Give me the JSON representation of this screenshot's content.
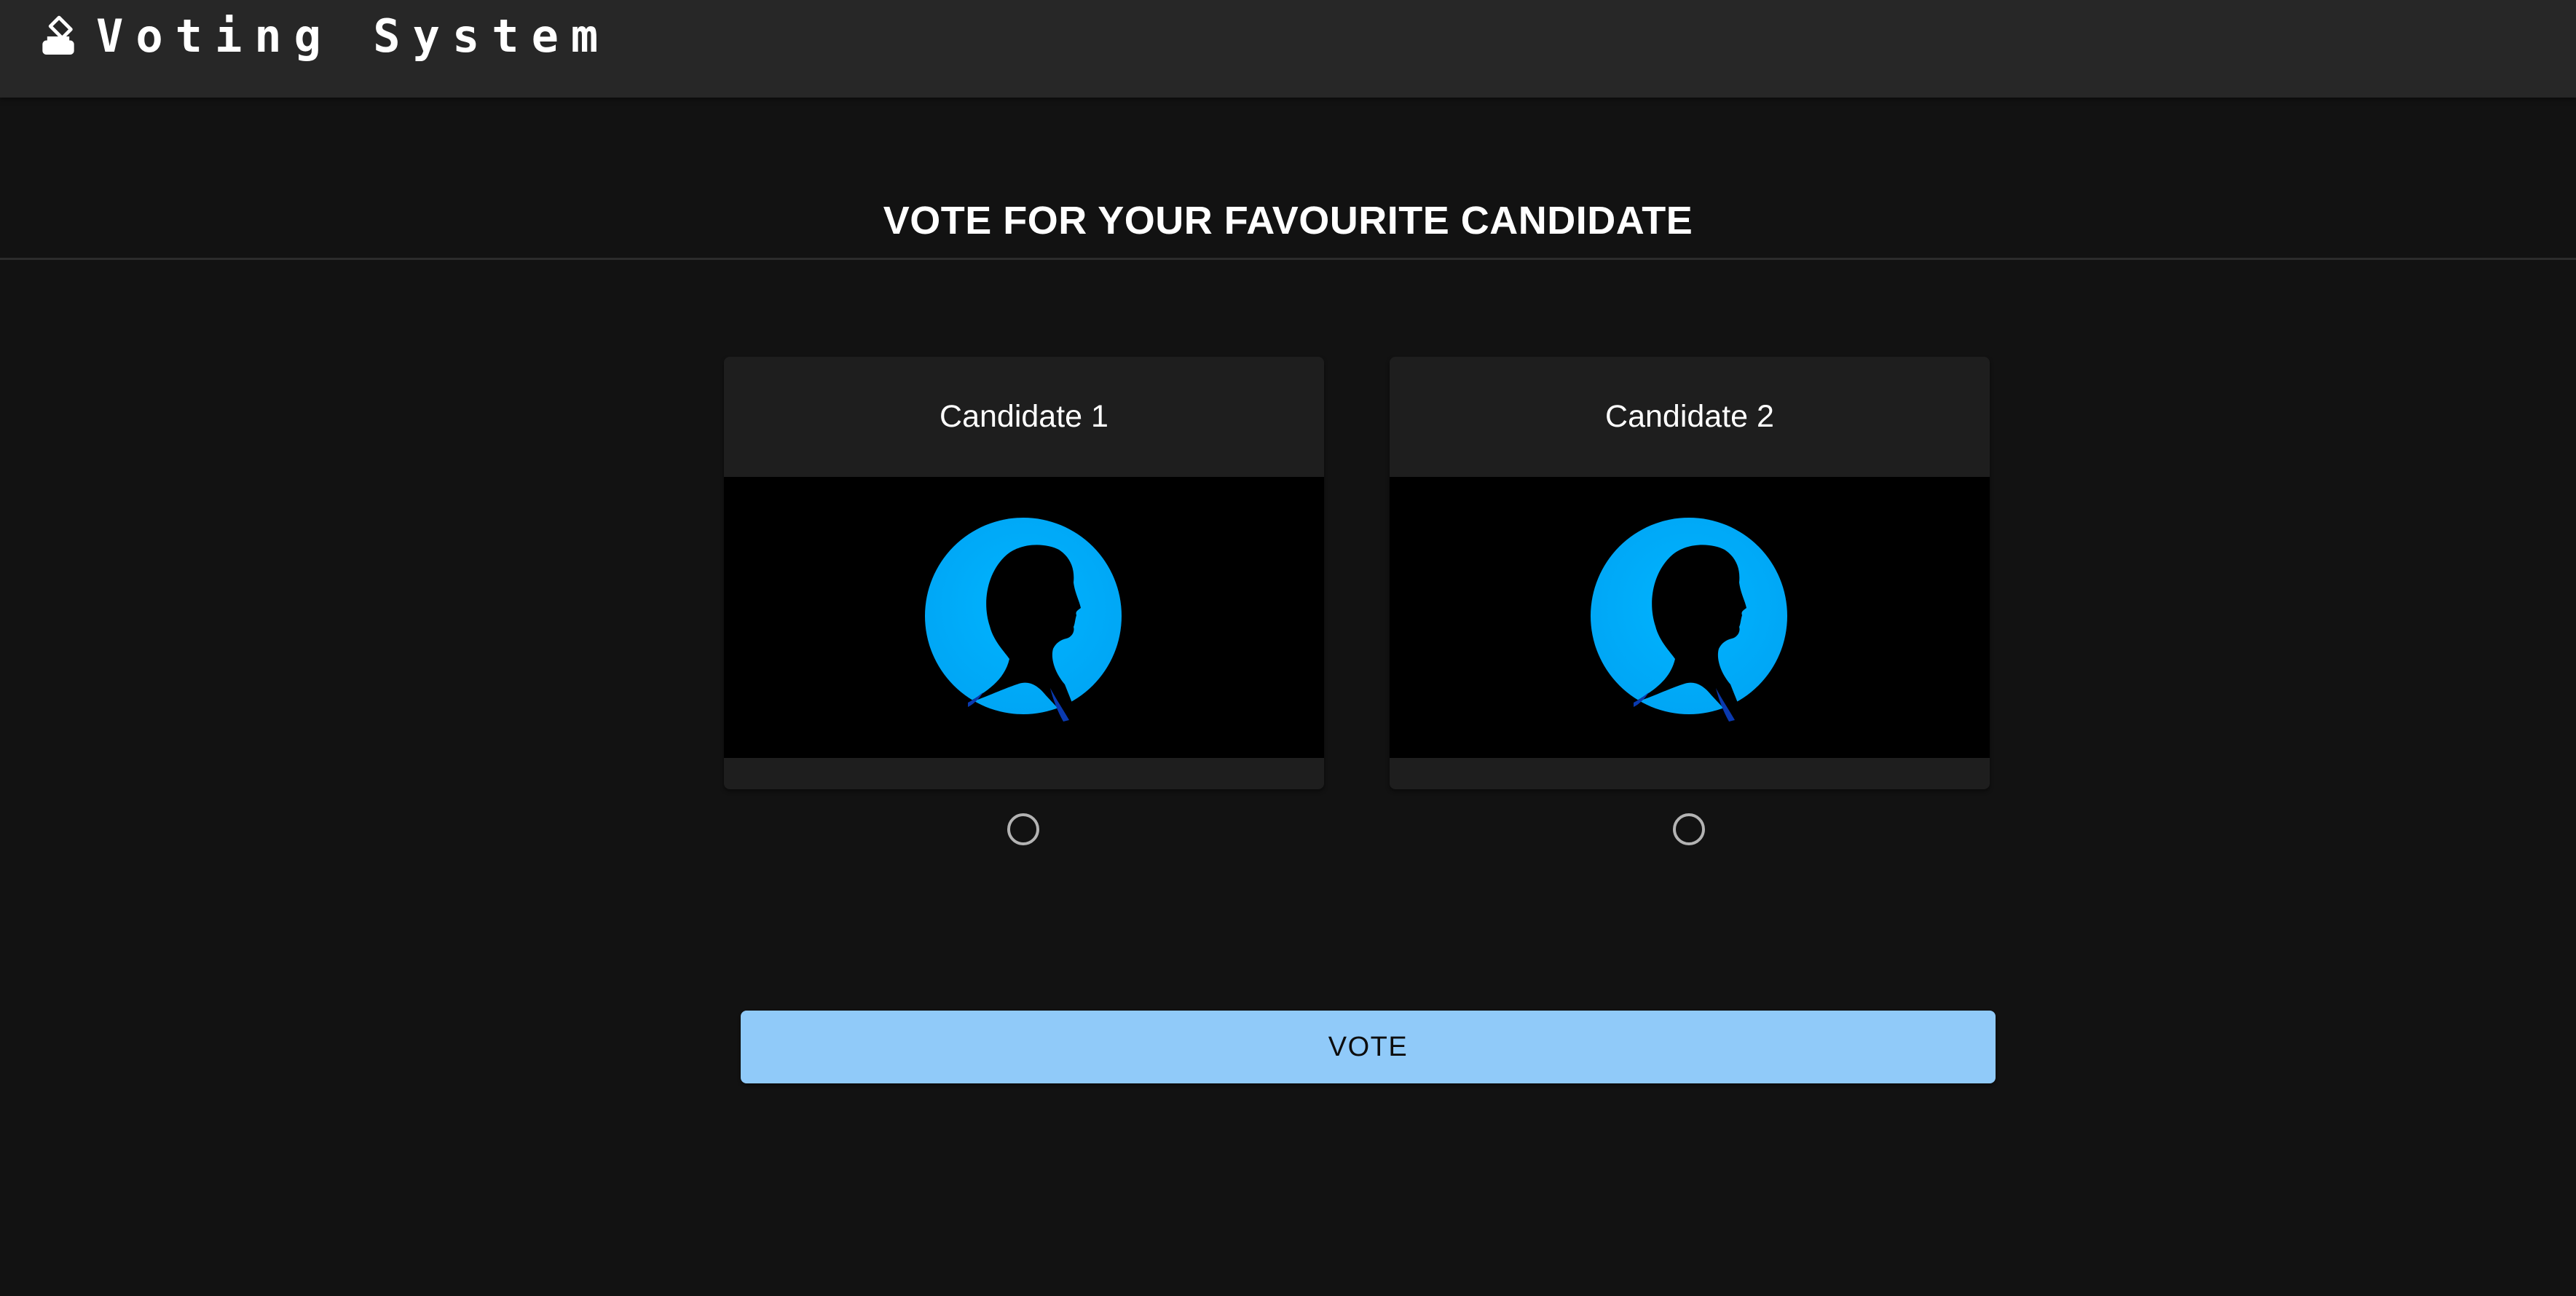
{
  "header": {
    "title": "Voting System",
    "icon": "ballot-box-icon"
  },
  "main": {
    "heading": "VOTE FOR YOUR FAVOURITE CANDIDATE",
    "candidates": [
      {
        "name": "Candidate 1",
        "image": "person-silhouette-icon",
        "selected": false
      },
      {
        "name": "Candidate 2",
        "image": "person-silhouette-icon",
        "selected": false
      }
    ],
    "vote_label": "VOTE"
  },
  "colors": {
    "background": "#121212",
    "appbar": "#272727",
    "card": "#1e1e1e",
    "accent": "#90caf9",
    "avatar_circle": "#00b0ff"
  }
}
